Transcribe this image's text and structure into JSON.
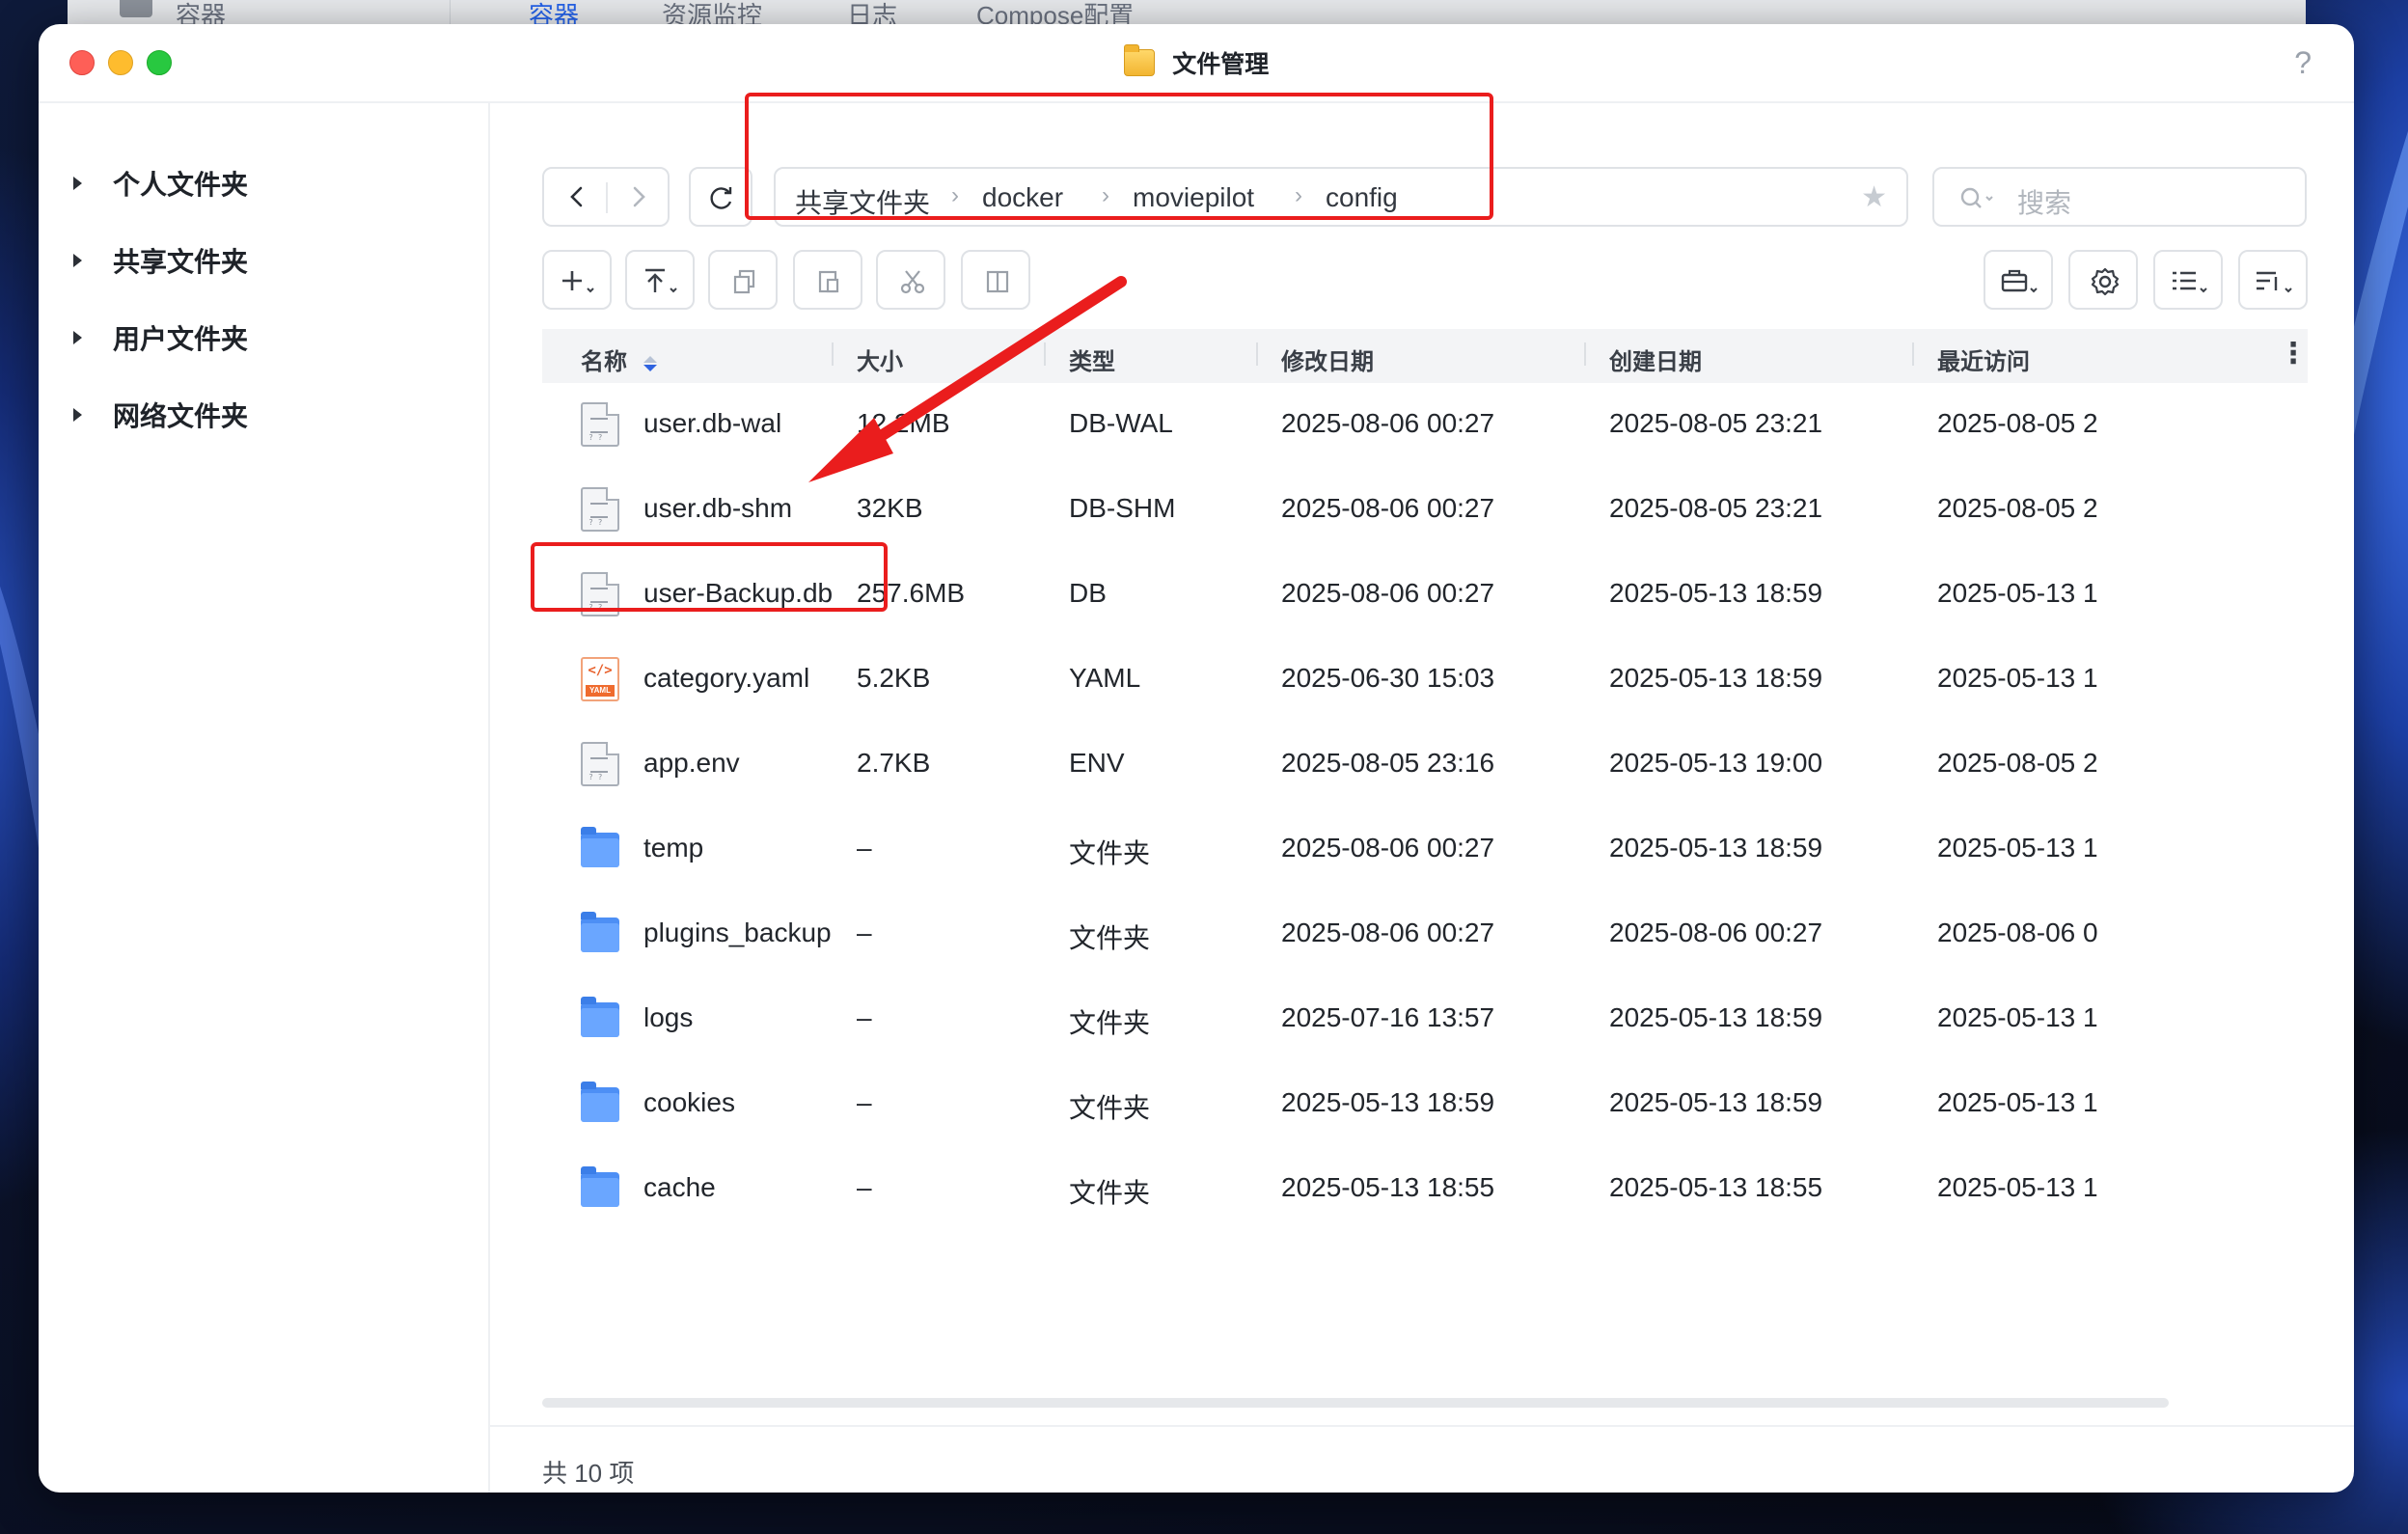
{
  "background_app": {
    "tabs": [
      "容器",
      "资源监控",
      "日志",
      "Compose配置"
    ],
    "first_label": "容器",
    "accent": "#2563eb"
  },
  "window": {
    "title": "文件管理",
    "help": "?"
  },
  "sidebar": {
    "items": [
      {
        "label": "个人文件夹"
      },
      {
        "label": "共享文件夹"
      },
      {
        "label": "用户文件夹"
      },
      {
        "label": "网络文件夹"
      }
    ]
  },
  "toolbar": {
    "back_icon": "chevron-left-icon",
    "forward_icon": "chevron-right-icon",
    "refresh_icon": "refresh-icon",
    "breadcrumb": [
      "共享文件夹",
      "docker",
      "moviepilot",
      "config"
    ],
    "favorite_icon": "star-icon",
    "search_placeholder": "搜索",
    "actions": [
      "new-icon",
      "upload-icon",
      "copy-icon",
      "paste-icon",
      "cut-icon",
      "move-icon"
    ],
    "view_actions": [
      "toolbox-icon",
      "settings-icon",
      "list-view-icon",
      "sort-icon"
    ]
  },
  "table": {
    "columns": {
      "name": "名称",
      "size": "大小",
      "type": "类型",
      "modified": "修改日期",
      "created": "创建日期",
      "accessed": "最近访问"
    },
    "sort": {
      "column": "name",
      "direction": "ascending"
    },
    "rows": [
      {
        "name": "user.db-wal",
        "size": "12.2MB",
        "type": "DB-WAL",
        "modified": "2025-08-06 00:27",
        "created": "2025-08-05 23:21",
        "accessed": "2025-08-05 2",
        "icon": "document-icon"
      },
      {
        "name": "user.db-shm",
        "size": "32KB",
        "type": "DB-SHM",
        "modified": "2025-08-06 00:27",
        "created": "2025-08-05 23:21",
        "accessed": "2025-08-05 2",
        "icon": "document-icon"
      },
      {
        "name": "user-Backup.db",
        "size": "257.6MB",
        "type": "DB",
        "modified": "2025-08-06 00:27",
        "created": "2025-05-13 18:59",
        "accessed": "2025-05-13 1",
        "icon": "document-icon"
      },
      {
        "name": "category.yaml",
        "size": "5.2KB",
        "type": "YAML",
        "modified": "2025-06-30 15:03",
        "created": "2025-05-13 18:59",
        "accessed": "2025-05-13 1",
        "icon": "yaml-file-icon"
      },
      {
        "name": "app.env",
        "size": "2.7KB",
        "type": "ENV",
        "modified": "2025-08-05 23:16",
        "created": "2025-05-13 19:00",
        "accessed": "2025-08-05 2",
        "icon": "document-icon"
      },
      {
        "name": "temp",
        "size": "–",
        "type": "文件夹",
        "modified": "2025-08-06 00:27",
        "created": "2025-05-13 18:59",
        "accessed": "2025-05-13 1",
        "icon": "folder-icon"
      },
      {
        "name": "plugins_backup",
        "size": "–",
        "type": "文件夹",
        "modified": "2025-08-06 00:27",
        "created": "2025-08-06 00:27",
        "accessed": "2025-08-06 0",
        "icon": "folder-icon"
      },
      {
        "name": "logs",
        "size": "–",
        "type": "文件夹",
        "modified": "2025-07-16 13:57",
        "created": "2025-05-13 18:59",
        "accessed": "2025-05-13 1",
        "icon": "folder-icon"
      },
      {
        "name": "cookies",
        "size": "–",
        "type": "文件夹",
        "modified": "2025-05-13 18:59",
        "created": "2025-05-13 18:59",
        "accessed": "2025-05-13 1",
        "icon": "folder-icon"
      },
      {
        "name": "cache",
        "size": "–",
        "type": "文件夹",
        "modified": "2025-05-13 18:55",
        "created": "2025-05-13 18:55",
        "accessed": "2025-05-13 1",
        "icon": "folder-icon"
      }
    ]
  },
  "footer": {
    "count_label": "共 10 项"
  },
  "annotations": {
    "color": "#ea1d1d",
    "highlighted_file": "user-Backup.db"
  }
}
